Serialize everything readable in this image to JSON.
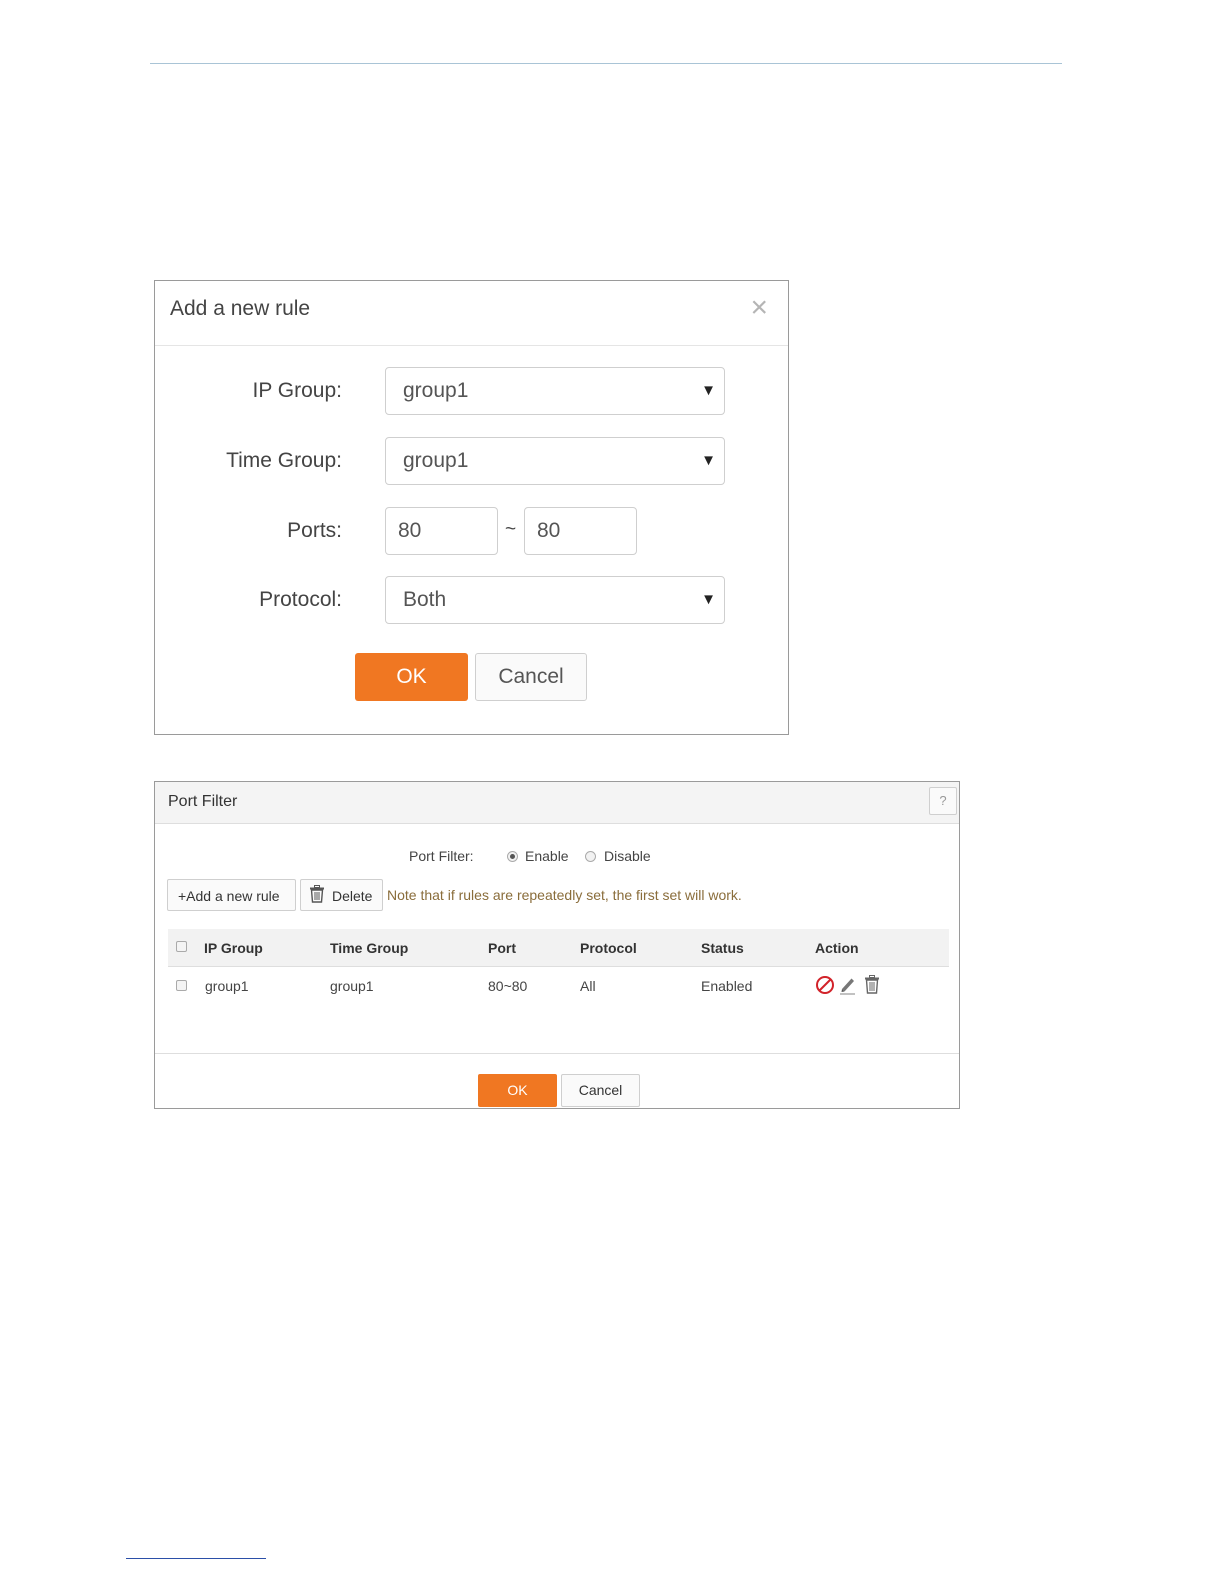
{
  "dialog": {
    "title": "Add a new rule",
    "close_glyph": "×",
    "fields": {
      "ip_group": {
        "label": "IP Group:",
        "value": "group1"
      },
      "time_group": {
        "label": "Time Group:",
        "value": "group1"
      },
      "ports": {
        "label": "Ports:",
        "start": "80",
        "separator": "~",
        "end": "80"
      },
      "protocol": {
        "label": "Protocol:",
        "value": "Both"
      }
    },
    "ok_label": "OK",
    "cancel_label": "Cancel"
  },
  "panel": {
    "title": "Port Filter",
    "help_glyph": "?",
    "port_filter": {
      "label": "Port Filter:",
      "options": [
        "Enable",
        "Disable"
      ],
      "selected": "Enable"
    },
    "add_button_label": "+Add a new rule",
    "delete_button_label": "Delete",
    "note": "Note that if rules are repeatedly set, the first set will work.",
    "table": {
      "headers": [
        "IP Group",
        "Time Group",
        "Port",
        "Protocol",
        "Status",
        "Action"
      ],
      "rows": [
        {
          "ip_group": "group1",
          "time_group": "group1",
          "port": "80~80",
          "protocol": "All",
          "status": "Enabled"
        }
      ],
      "action_icons": [
        "disable-icon",
        "edit-icon",
        "trash-icon"
      ]
    },
    "ok_label": "OK",
    "cancel_label": "Cancel"
  },
  "colors": {
    "accent_orange": "#f07722",
    "note_text": "#8a6d3b",
    "disable_icon_red": "#d2232a"
  }
}
